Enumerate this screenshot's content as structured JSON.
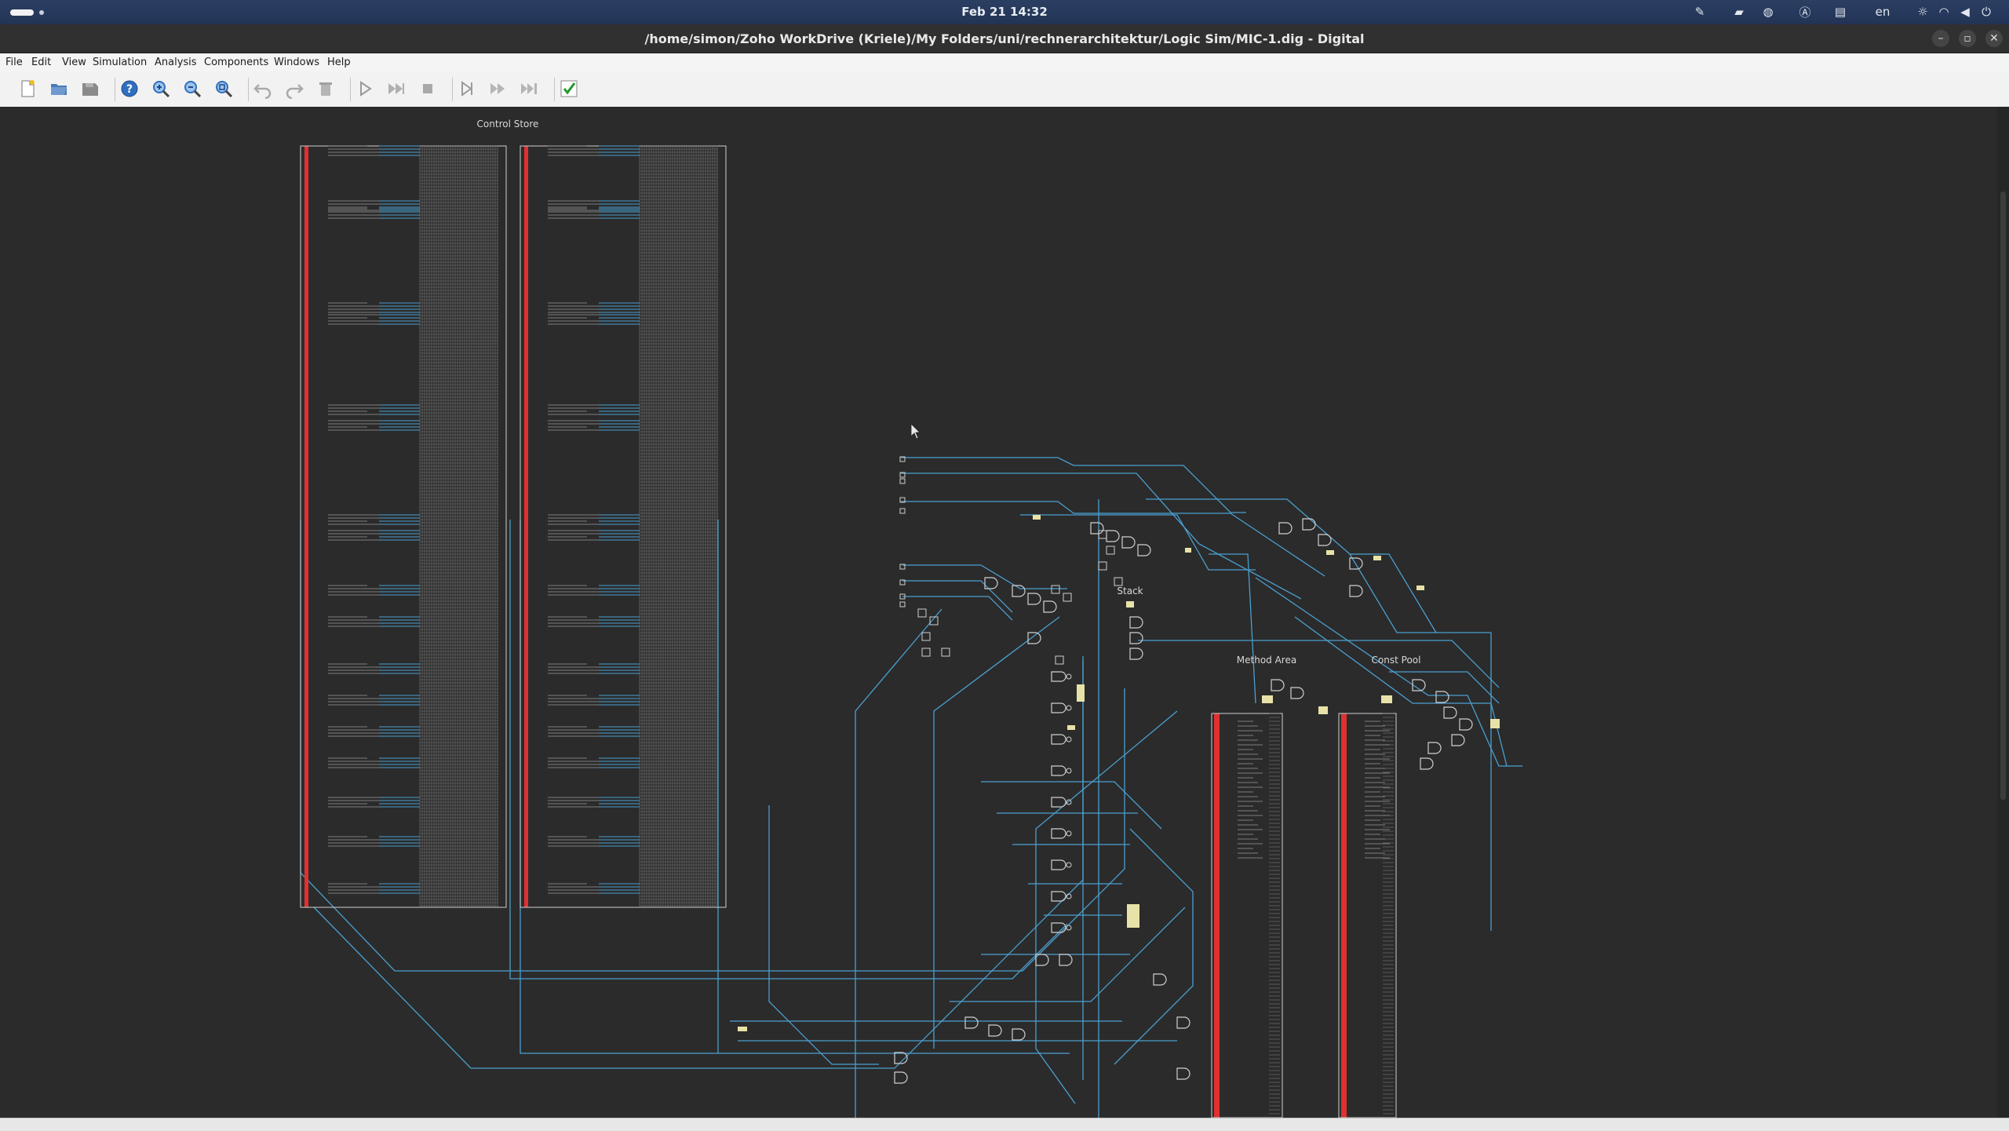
{
  "topbar": {
    "clock": "Feb 21  14:32",
    "language": "en",
    "icons": [
      "pen-icon",
      "folder-icon",
      "browser-icon",
      "a-icon",
      "clipboard-icon",
      "brightness-icon",
      "wifi-icon",
      "volume-icon",
      "power-icon"
    ]
  },
  "window": {
    "title": "/home/simon/Zoho WorkDrive (Kriele)/My Folders/uni/rechnerarchitektur/Logic Sim/MIC-1.dig - Digital"
  },
  "menu": {
    "items": [
      "File",
      "Edit",
      "View",
      "Simulation",
      "Analysis",
      "Components",
      "Windows",
      "Help"
    ]
  },
  "toolbar": {
    "buttons": [
      "new",
      "open",
      "save",
      "help",
      "zoom-in",
      "zoom-out",
      "zoom-fit",
      "undo",
      "redo",
      "delete",
      "start-simulation",
      "run-to-break",
      "stop",
      "step",
      "step-micro",
      "run-to-end",
      "verify"
    ]
  },
  "circuit": {
    "labels": {
      "control_store": "Control Store",
      "stack": "Stack",
      "method_area": "Method Area",
      "const_pool": "Const Pool"
    }
  },
  "colors": {
    "wire": "#4a9fd0",
    "bus": "#6ab0d8",
    "red_bar": "#e03030",
    "component": "#cfcfcf",
    "io_yellow": "#e8e2a8",
    "background": "#2b2b2b"
  }
}
